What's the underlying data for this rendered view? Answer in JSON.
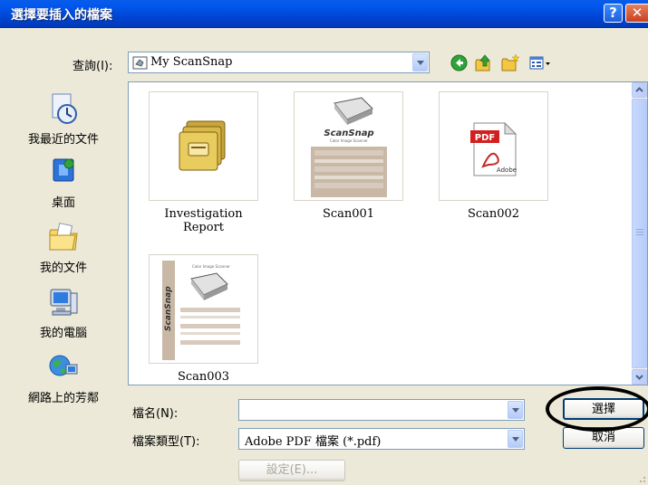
{
  "window": {
    "title": "選擇要插入的檔案",
    "help_glyph": "?",
    "close_glyph": "✕"
  },
  "lookin": {
    "label": "查詢(I):",
    "value": "My ScanSnap"
  },
  "toolbar_icons": [
    "back-icon",
    "up-folder-icon",
    "new-folder-icon",
    "views-menu-icon"
  ],
  "places": [
    {
      "label": "我最近的文件",
      "icon": "recent-documents-icon"
    },
    {
      "label": "桌面",
      "icon": "desktop-icon"
    },
    {
      "label": "我的文件",
      "icon": "my-documents-icon"
    },
    {
      "label": "我的電腦",
      "icon": "my-computer-icon"
    },
    {
      "label": "網路上的芳鄰",
      "icon": "network-places-icon"
    }
  ],
  "files": [
    {
      "name": "Investigation Report",
      "icon": "folder-icon"
    },
    {
      "name": "Scan001",
      "icon": "scansnap-thumbnail"
    },
    {
      "name": "Scan002",
      "icon": "pdf-icon"
    },
    {
      "name": "Scan003",
      "icon": "scansnap-thumbnail"
    }
  ],
  "thumb_text": {
    "brand": "ScanSnap",
    "subtitle": "Color Image Scanner",
    "pdf": "PDF",
    "adobe": "Adobe"
  },
  "filename": {
    "label": "檔名(N):",
    "value": ""
  },
  "filetype": {
    "label": "檔案類型(T):",
    "value": "Adobe PDF 檔案 (*.pdf)"
  },
  "buttons": {
    "select": "選擇",
    "cancel": "取消",
    "settings": "設定(E)..."
  },
  "colors": {
    "title_bar": "#0054E3",
    "dialog_bg": "#ECE9D8",
    "highlight_oval": "#000000"
  }
}
